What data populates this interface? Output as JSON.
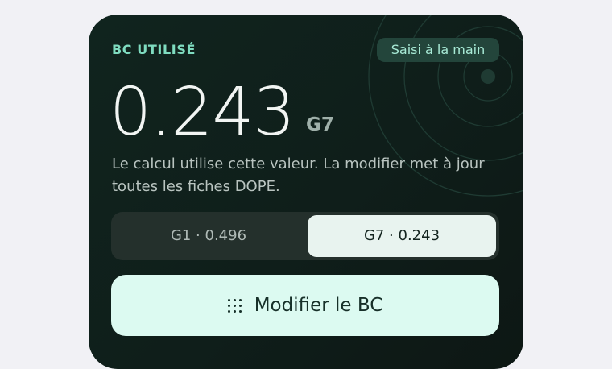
{
  "card": {
    "label": "BC UTILISÉ",
    "badge": "Saisi à la main",
    "value": "0.243",
    "unit": "G7",
    "description": "Le calcul utilise cette valeur. La modifier met à jour toutes les fiches DOPE."
  },
  "segments": [
    {
      "label": "G1 · 0.496",
      "selected": false
    },
    {
      "label": "G7 · 0.243",
      "selected": true
    }
  ],
  "button": {
    "label": "Modifier le BC",
    "icon": "grid-dots-icon"
  },
  "colors": {
    "accent": "#7fdcc0",
    "card_bg": "#0f1e1a",
    "button_bg": "#dcfaf1"
  }
}
